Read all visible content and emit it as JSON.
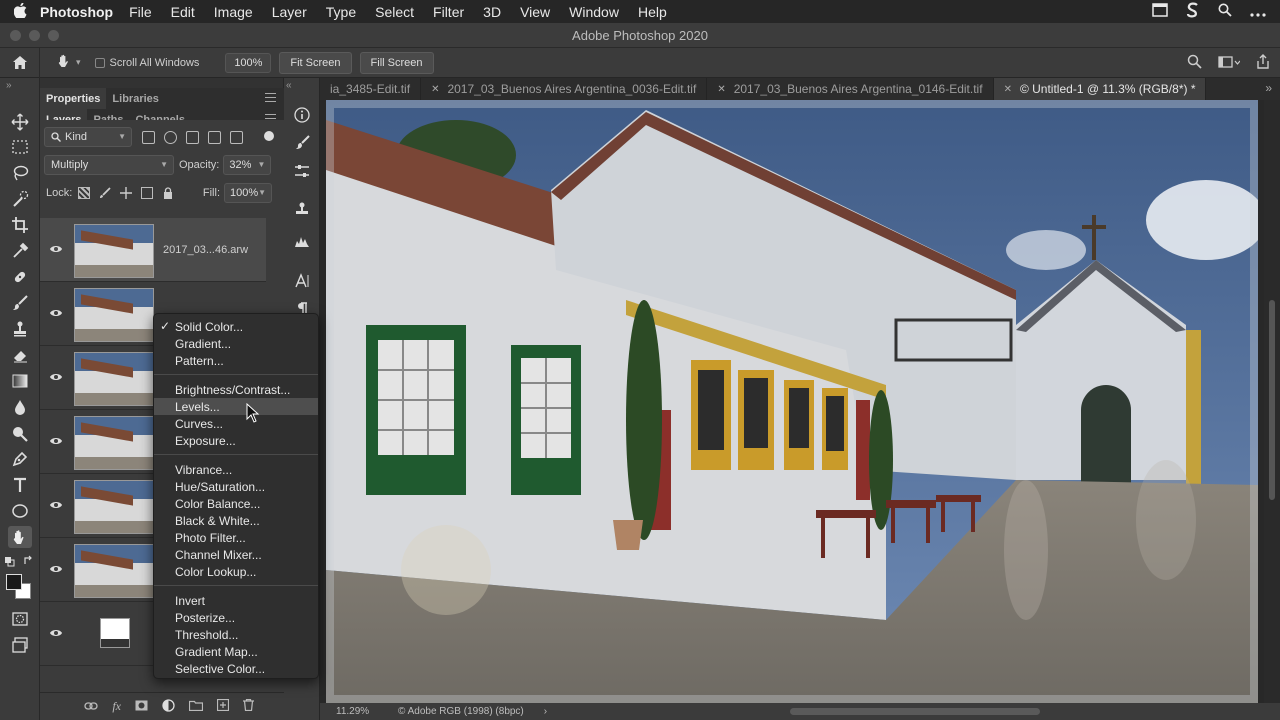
{
  "menubar": {
    "app_name": "Photoshop",
    "items": [
      "File",
      "Edit",
      "Image",
      "Layer",
      "Type",
      "Select",
      "Filter",
      "3D",
      "View",
      "Window",
      "Help"
    ]
  },
  "window": {
    "title": "Adobe Photoshop 2020"
  },
  "options_bar": {
    "scroll_all_windows": "Scroll All Windows",
    "zoom_value": "100%",
    "fit_screen": "Fit Screen",
    "fill_screen": "Fill Screen"
  },
  "panels": {
    "top_tabs": [
      "Properties",
      "Libraries"
    ],
    "layer_tabs": [
      "Layers",
      "Paths",
      "Channels"
    ],
    "kind_filter": "Kind",
    "blend_mode": "Multiply",
    "opacity_label": "Opacity:",
    "opacity_value": "32%",
    "lock_label": "Lock:",
    "fill_label": "Fill:",
    "fill_value": "100%",
    "layers": [
      {
        "name": "2017_03...46.arw",
        "selected": true
      },
      {
        "name": ""
      },
      {
        "name": ""
      },
      {
        "name": ""
      },
      {
        "name": ""
      },
      {
        "name": ""
      },
      {
        "name": ""
      }
    ]
  },
  "document_tabs": [
    {
      "label": "ia_3485-Edit.tif",
      "active": false
    },
    {
      "label": "2017_03_Buenos Aires Argentina_0036-Edit.tif",
      "active": false
    },
    {
      "label": "2017_03_Buenos Aires Argentina_0146-Edit.tif",
      "active": false
    },
    {
      "label": "© Untitled-1 @ 11.3% (RGB/8*) *",
      "active": true
    }
  ],
  "status_bar": {
    "zoom": "11.29%",
    "profile": "© Adobe RGB (1998) (8bpc)"
  },
  "adjustment_menu": {
    "groups": [
      [
        {
          "label": "Solid Color...",
          "checked": true
        },
        {
          "label": "Gradient..."
        },
        {
          "label": "Pattern..."
        }
      ],
      [
        {
          "label": "Brightness/Contrast..."
        },
        {
          "label": "Levels...",
          "highlighted": true
        },
        {
          "label": "Curves..."
        },
        {
          "label": "Exposure..."
        }
      ],
      [
        {
          "label": "Vibrance..."
        },
        {
          "label": "Hue/Saturation..."
        },
        {
          "label": "Color Balance..."
        },
        {
          "label": "Black & White..."
        },
        {
          "label": "Photo Filter..."
        },
        {
          "label": "Channel Mixer..."
        },
        {
          "label": "Color Lookup..."
        }
      ],
      [
        {
          "label": "Invert"
        },
        {
          "label": "Posterize..."
        },
        {
          "label": "Threshold..."
        },
        {
          "label": "Gradient Map..."
        },
        {
          "label": "Selective Color..."
        }
      ]
    ]
  }
}
